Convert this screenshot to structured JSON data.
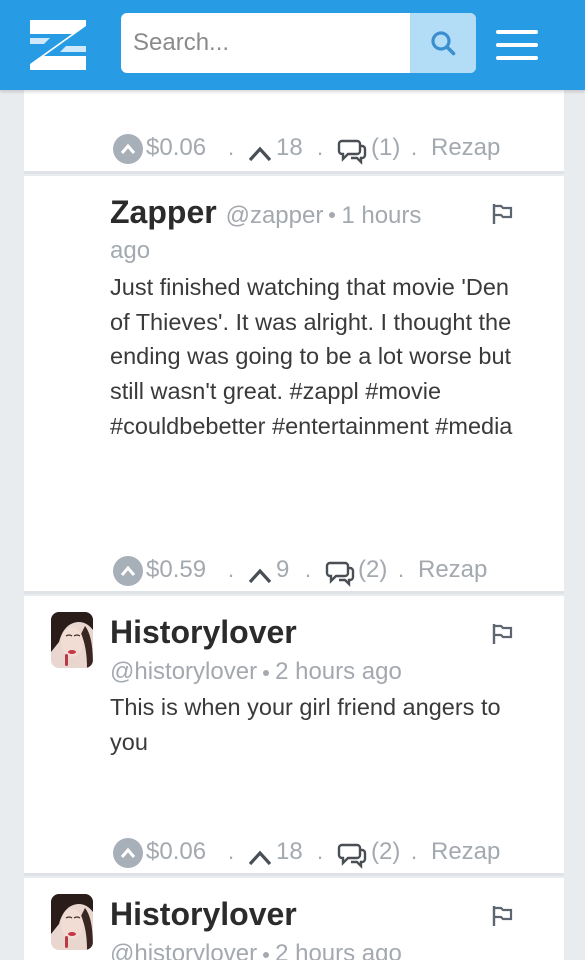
{
  "header": {
    "search_placeholder": "Search...",
    "brand_color": "#279be4"
  },
  "posts": [
    {
      "author": "",
      "handle": "",
      "time": "",
      "text": "",
      "stats": {
        "tip": "$0.06",
        "upvotes": "18",
        "comments": "(1)",
        "rezap": "Rezap"
      }
    },
    {
      "author": "Zapper",
      "handle": "@zapper",
      "time": "1 hours",
      "time_cont": "ago",
      "text": "Just finished watching that movie 'Den of Thieves'. It was alright. I thought the ending was going to be a lot worse but still wasn't great. #zappl #movie #couldbebetter #entertainment #media",
      "stats": {
        "tip": "$0.59",
        "upvotes": "9",
        "comments": "(2)",
        "rezap": "Rezap"
      }
    },
    {
      "author": "Historylover",
      "handle": "@historylover",
      "time": "2 hours ago",
      "text": "This is when your girl friend angers to you",
      "stats": {
        "tip": "$0.06",
        "upvotes": "18",
        "comments": "(2)",
        "rezap": "Rezap"
      }
    },
    {
      "author": "Historylover",
      "handle": "@historylover",
      "time": "2 hours ago",
      "text": ""
    }
  ],
  "separator": "."
}
